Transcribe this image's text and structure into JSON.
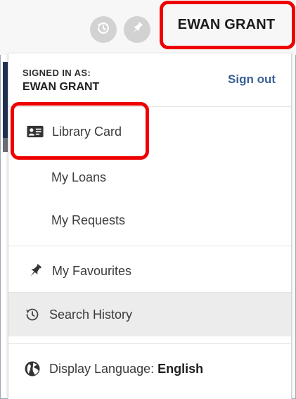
{
  "header": {
    "user_name": "EWAN GRANT",
    "history_icon": "history-icon",
    "pin_icon": "pin-icon"
  },
  "menu": {
    "signed_in_label": "SIGNED IN AS:",
    "signed_in_name": "EWAN GRANT",
    "sign_out": "Sign out",
    "items": [
      {
        "label": "Library Card",
        "icon": "id-card-icon"
      },
      {
        "label": "My Loans"
      },
      {
        "label": "My Requests"
      },
      {
        "label": "My Favourites",
        "icon": "pin-icon"
      },
      {
        "label": "Search History",
        "icon": "history-icon",
        "active": true
      }
    ],
    "language_label": "Display Language:",
    "language_value": "English",
    "language_icon": "globe-icon"
  },
  "colors": {
    "highlight": "#ee0000",
    "link": "#3a6096",
    "nav_accent": "#1f3152"
  }
}
